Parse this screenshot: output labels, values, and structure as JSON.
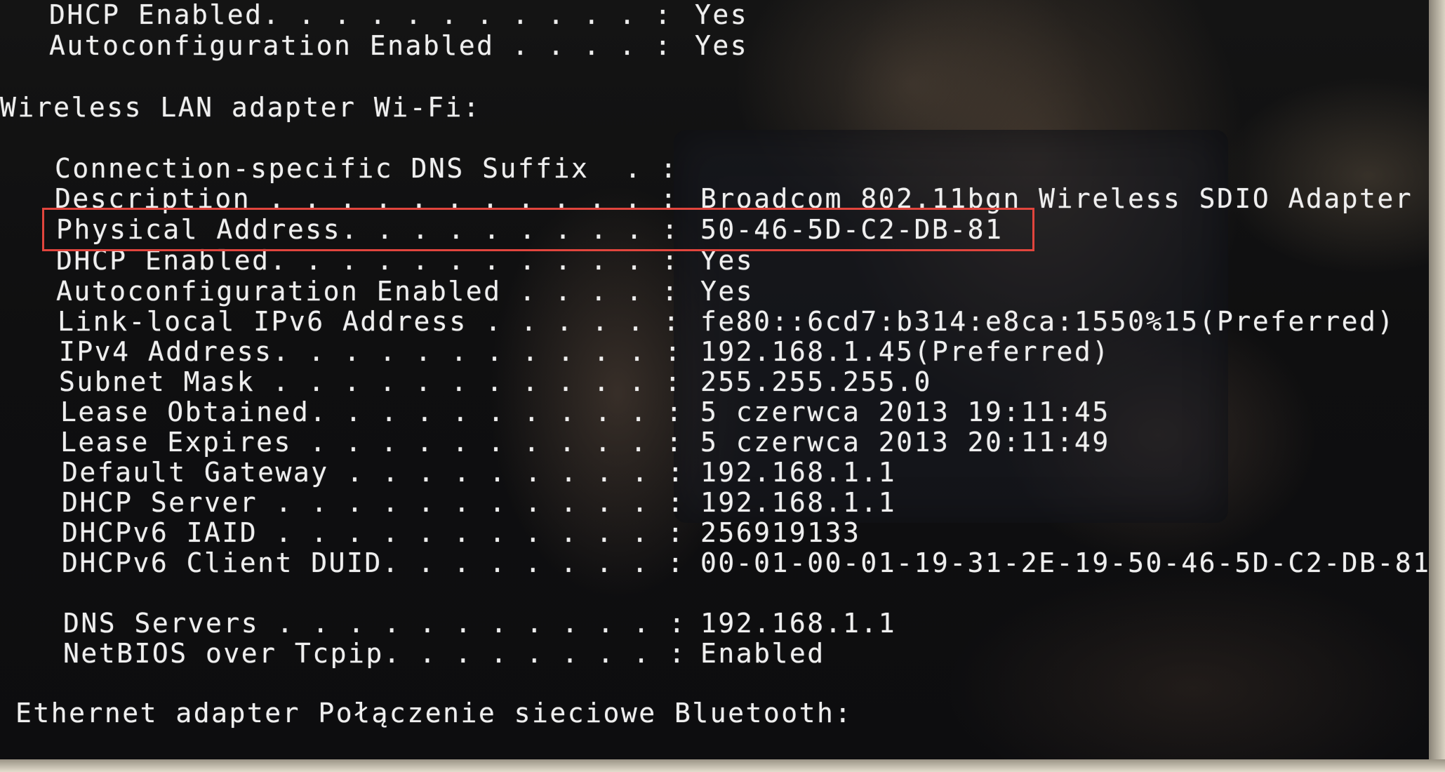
{
  "top_lines": [
    {
      "label": "DHCP Enabled. . . . . . . . . . . :",
      "value": "Yes"
    },
    {
      "label": "Autoconfiguration Enabled . . . . :",
      "value": "Yes"
    }
  ],
  "wifi_section": {
    "header": "Wireless LAN adapter Wi-Fi:",
    "rows": [
      {
        "label": "Connection-specific DNS Suffix  . :",
        "value": ""
      },
      {
        "label": "Description . . . . . . . . . . . :",
        "value": "Broadcom 802.11bgn Wireless SDIO Adapter"
      },
      {
        "label": "Physical Address. . . . . . . . . :",
        "value": "50-46-5D-C2-DB-81"
      },
      {
        "label": "DHCP Enabled. . . . . . . . . . . :",
        "value": "Yes"
      },
      {
        "label": "Autoconfiguration Enabled . . . . :",
        "value": "Yes"
      },
      {
        "label": "Link-local IPv6 Address . . . . . :",
        "value": "fe80::6cd7:b314:e8ca:1550%15(Preferred)"
      },
      {
        "label": "IPv4 Address. . . . . . . . . . . :",
        "value": "192.168.1.45(Preferred)"
      },
      {
        "label": "Subnet Mask . . . . . . . . . . . :",
        "value": "255.255.255.0"
      },
      {
        "label": "Lease Obtained. . . . . . . . . . :",
        "value": "5 czerwca 2013 19:11:45"
      },
      {
        "label": "Lease Expires . . . . . . . . . . :",
        "value": "5 czerwca 2013 20:11:49"
      },
      {
        "label": "Default Gateway . . . . . . . . . :",
        "value": "192.168.1.1"
      },
      {
        "label": "DHCP Server . . . . . . . . . . . :",
        "value": "192.168.1.1"
      },
      {
        "label": "DHCPv6 IAID . . . . . . . . . . . :",
        "value": "256919133"
      },
      {
        "label": "DHCPv6 Client DUID. . . . . . . . :",
        "value": "00-01-00-01-19-31-2E-19-50-46-5D-C2-DB-81"
      },
      {
        "label": "DNS Servers . . . . . . . . . . . :",
        "value": "192.168.1.1"
      },
      {
        "label": "NetBIOS over Tcpip. . . . . . . . :",
        "value": "Enabled"
      }
    ]
  },
  "bluetooth_section": {
    "header": "Ethernet adapter Połączenie sieciowe Bluetooth:"
  },
  "highlight": {
    "color": "#e1453d",
    "target": "Physical Address"
  },
  "colors": {
    "text": "#efefef",
    "background": "#111111"
  }
}
